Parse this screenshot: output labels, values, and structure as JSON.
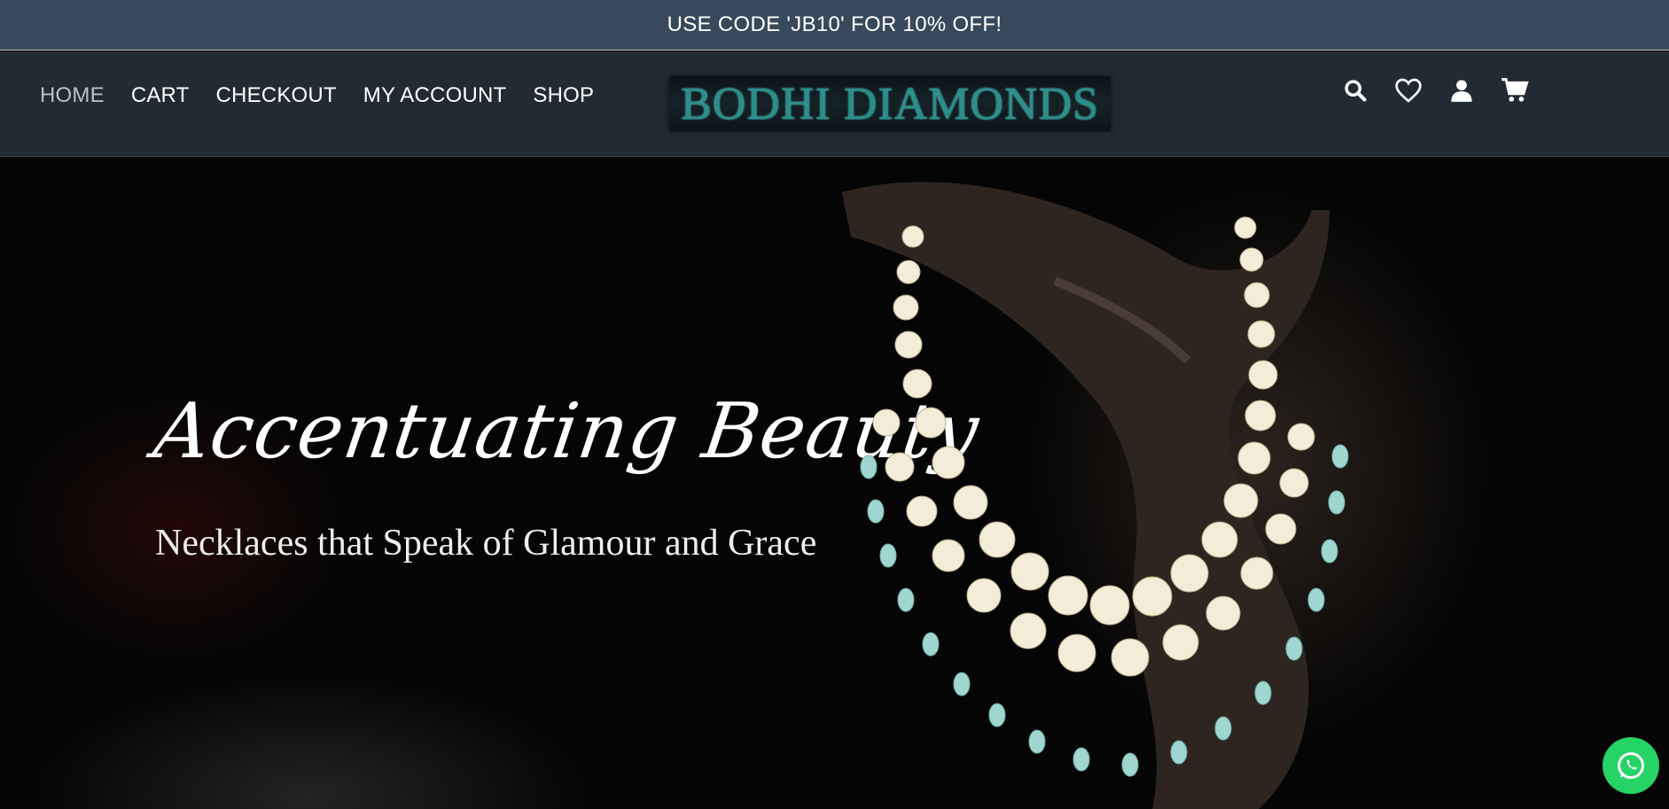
{
  "promo": {
    "text": "USE CODE 'JB10' FOR 10% OFF!"
  },
  "nav": {
    "items": [
      {
        "label": "HOME",
        "active": true
      },
      {
        "label": "CART"
      },
      {
        "label": "CHECKOUT"
      },
      {
        "label": "MY ACCOUNT"
      },
      {
        "label": "SHOP"
      }
    ]
  },
  "logo": {
    "text": "BODHI DIAMONDS"
  },
  "header_icons": [
    "search-icon",
    "heart-icon",
    "user-icon",
    "cart-icon"
  ],
  "hero": {
    "title": "Accentuating Beauty",
    "subtitle": "Necklaces that Speak of Glamour and Grace"
  },
  "colors": {
    "promo_bg": "#37495a",
    "header_bg": "#222a33",
    "logo_teal": "#2a8f8c",
    "whatsapp": "#25d366"
  }
}
